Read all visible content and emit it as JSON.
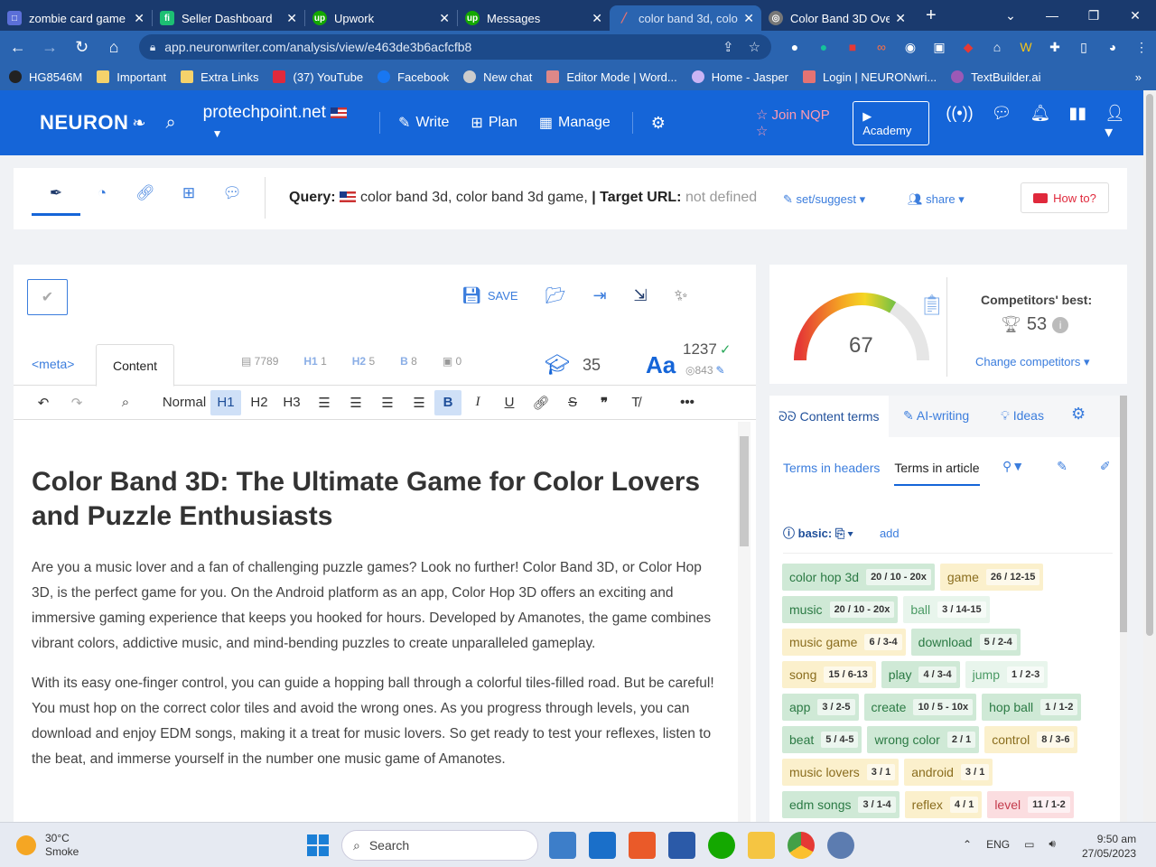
{
  "browser": {
    "tabs": [
      {
        "title": "zombie card game",
        "icon_color": "#5b6fd8"
      },
      {
        "title": "Seller Dashboard",
        "icon_color": "#1dbf73"
      },
      {
        "title": "Upwork",
        "icon_color": "#14a800"
      },
      {
        "title": "Messages",
        "icon_color": "#14a800"
      },
      {
        "title": "color band 3d, colo",
        "icon_color": "#e57373"
      },
      {
        "title": "Color Band 3D Ove",
        "icon_color": "#777777"
      }
    ],
    "active_tab": 4,
    "url": "app.neuronwriter.com/analysis/view/e463de3b6acfcfb8",
    "bookmarks": [
      "HG8546M",
      "Important",
      "Extra Links",
      "(37) YouTube",
      "Facebook",
      "New chat",
      "Editor Mode | Word...",
      "Home - Jasper",
      "Login | NEURONwri...",
      "TextBuilder.ai"
    ]
  },
  "app": {
    "logo": "NEURON",
    "project": "protechpoint.net",
    "nav": [
      "Write",
      "Plan",
      "Manage"
    ],
    "join": "Join NQP",
    "academy": "Academy"
  },
  "query_bar": {
    "query_label": "Query:",
    "query_value": "color band 3d, color band 3d game,",
    "target_label": "| Target URL:",
    "target_value": "not defined",
    "set_suggest": "set/suggest",
    "share": "share",
    "how_to": "How to?"
  },
  "editor": {
    "save_label": "SAVE",
    "tab_meta": "<meta>",
    "tab_content": "Content",
    "stats": {
      "words_icon_count": "7789",
      "h1": "1",
      "h2": "5",
      "b": "8",
      "img": "0"
    },
    "grade": "35",
    "word_count": "1237",
    "sub_count": "843",
    "format": [
      "Normal",
      "H1",
      "H2",
      "H3"
    ],
    "heading": "Color Band 3D: The Ultimate Game for Color Lovers and Puzzle Enthusiasts",
    "paragraphs": [
      "Are you a music lover and a fan of challenging puzzle games? Look no further! Color Band 3D, or Color Hop 3D, is the perfect game for you. On the Android platform as an app, Color Hop 3D offers an exciting and immersive gaming experience that keeps you hooked for hours. Developed by Amanotes, the game combines vibrant colors, addictive music, and mind-bending puzzles to create unparalleled gameplay.",
      "With its easy one-finger control, you can guide a hopping ball through a colorful tiles-filled road. But be careful! You must hop on the correct color tiles and avoid the wrong ones. As you progress through levels, you can download and enjoy EDM songs, making it a treat for music lovers. So get ready to test your reflexes, listen to the beat, and immerse yourself in the number one music game of Amanotes."
    ]
  },
  "score": {
    "value": 67,
    "competitors_label": "Competitors' best:",
    "competitors_value": "53",
    "change": "Change competitors"
  },
  "terms": {
    "tabs": [
      "Content terms",
      "AI-writing",
      "Ideas"
    ],
    "sub_headers": "Terms in headers",
    "sub_article": "Terms in article",
    "basic_label": "basic:",
    "add": "add",
    "chips": [
      {
        "t": "color hop 3d",
        "c": "20 / 10 - 20x",
        "k": "green"
      },
      {
        "t": "game",
        "c": "26 / 12-15",
        "k": "yellow"
      },
      {
        "t": "music",
        "c": "20 / 10 - 20x",
        "k": "green"
      },
      {
        "t": "ball",
        "c": "3 / 14-15",
        "k": "lgreen"
      },
      {
        "t": "music game",
        "c": "6 / 3-4",
        "k": "yellow"
      },
      {
        "t": "download",
        "c": "5 / 2-4",
        "k": "green"
      },
      {
        "t": "song",
        "c": "15 / 6-13",
        "k": "yellow"
      },
      {
        "t": "play",
        "c": "4 / 3-4",
        "k": "green"
      },
      {
        "t": "jump",
        "c": "1 / 2-3",
        "k": "lgreen"
      },
      {
        "t": "app",
        "c": "3 / 2-5",
        "k": "green"
      },
      {
        "t": "create",
        "c": "10 / 5 - 10x",
        "k": "green"
      },
      {
        "t": "hop ball",
        "c": "1 / 1-2",
        "k": "green"
      },
      {
        "t": "beat",
        "c": "5 / 4-5",
        "k": "green"
      },
      {
        "t": "wrong color",
        "c": "2 / 1",
        "k": "green"
      },
      {
        "t": "control",
        "c": "8 / 3-6",
        "k": "yellow"
      },
      {
        "t": "music lovers",
        "c": "3 / 1",
        "k": "yellow"
      },
      {
        "t": "android",
        "c": "3 / 1",
        "k": "yellow"
      },
      {
        "t": "edm songs",
        "c": "3 / 1-4",
        "k": "green"
      },
      {
        "t": "reflex",
        "c": "4 / 1",
        "k": "yellow"
      },
      {
        "t": "level",
        "c": "11 / 1-2",
        "k": "red"
      }
    ]
  },
  "taskbar": {
    "temp": "30°C",
    "weather": "Smoke",
    "search": "Search",
    "lang": "ENG",
    "time": "9:50 am",
    "date": "27/05/2023"
  }
}
